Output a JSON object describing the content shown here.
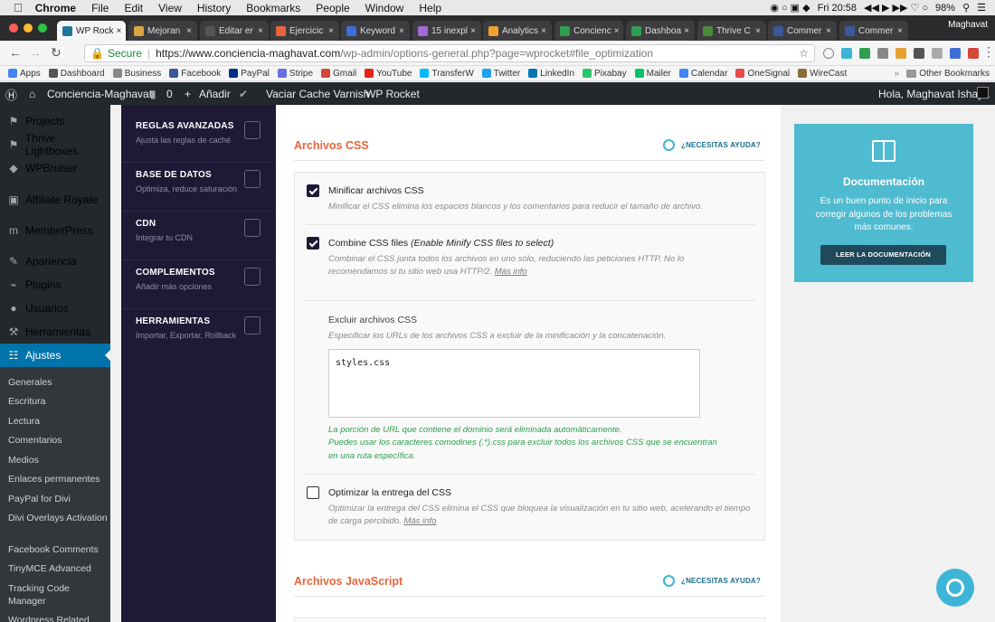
{
  "mac_menu": {
    "app": "Chrome",
    "items": [
      "File",
      "Edit",
      "View",
      "History",
      "Bookmarks",
      "People",
      "Window",
      "Help"
    ],
    "clock": "Fri 20:58",
    "battery": "98%"
  },
  "tabs": [
    {
      "label": "WP Rock",
      "color": "#21759b",
      "active": true
    },
    {
      "label": "Mejoran",
      "color": "#d9a441"
    },
    {
      "label": "Editar er",
      "color": "#555"
    },
    {
      "label": "Ejercicic",
      "color": "#e8653b"
    },
    {
      "label": "Keyword",
      "color": "#3b6fd6"
    },
    {
      "label": "15 inexpl",
      "color": "#a26ad6"
    },
    {
      "label": "Analytics",
      "color": "#f0a030"
    },
    {
      "label": "Concienc",
      "color": "#2e9e50"
    },
    {
      "label": "Dashboa",
      "color": "#2e9e50"
    },
    {
      "label": "Thrive C",
      "color": "#4a8a3a"
    },
    {
      "label": "Commer",
      "color": "#3b5998"
    },
    {
      "label": "Commer",
      "color": "#3b5998"
    }
  ],
  "profile": "Maghavat",
  "address": {
    "secure": "Secure",
    "host": "https://www.conciencia-maghavat.com",
    "path": "/wp-admin/options-general.php?page=wprocket#file_optimization"
  },
  "bookmarks": [
    {
      "label": "Apps",
      "color": "#4285f4"
    },
    {
      "label": "Dashboard",
      "color": "#555"
    },
    {
      "label": "Business",
      "color": "#888"
    },
    {
      "label": "Facebook",
      "color": "#3b5998"
    },
    {
      "label": "PayPal",
      "color": "#003087"
    },
    {
      "label": "Stripe",
      "color": "#6772e5"
    },
    {
      "label": "Gmail",
      "color": "#d44638"
    },
    {
      "label": "YouTube",
      "color": "#e62117"
    },
    {
      "label": "TransferW",
      "color": "#00b9ff"
    },
    {
      "label": "Twitter",
      "color": "#1da1f2"
    },
    {
      "label": "LinkedIn",
      "color": "#0077b5"
    },
    {
      "label": "Pixabay",
      "color": "#2ec66d"
    },
    {
      "label": "Mailer",
      "color": "#09c269"
    },
    {
      "label": "Calendar",
      "color": "#4285f4"
    },
    {
      "label": "OneSignal",
      "color": "#e54b4d"
    },
    {
      "label": "WireCast",
      "color": "#8a6d3b"
    }
  ],
  "other_bookmarks": "Other Bookmarks",
  "admin_bar": {
    "site": "Conciencia-Maghavat",
    "comments": "0",
    "add": "Añadir",
    "varnish": "Vaciar Cache Varnish",
    "rocket": "WP Rocket",
    "greeting": "Hola, Maghavat Ishaya"
  },
  "wp_menu": [
    {
      "label": "Projects",
      "icon": "pin-icon"
    },
    {
      "label": "Thrive Lightboxes",
      "icon": "pin-icon"
    },
    {
      "label": "WPBruiser",
      "icon": "shield-icon"
    },
    {
      "label": "Affiliate Royale",
      "icon": "wallet-icon"
    },
    {
      "label": "MemberPress",
      "icon": "mp-icon"
    },
    {
      "label": "Apariencia",
      "icon": "brush-icon"
    },
    {
      "label": "Plugins",
      "icon": "plug-icon"
    },
    {
      "label": "Usuarios",
      "icon": "user-icon"
    },
    {
      "label": "Herramientas",
      "icon": "wrench-icon"
    },
    {
      "label": "Ajustes",
      "icon": "settings-icon",
      "active": true
    }
  ],
  "wp_submenu": [
    "Generales",
    "Escritura",
    "Lectura",
    "Comentarios",
    "Medios",
    "Enlaces permanentes",
    "PayPal for Divi",
    "Divi Overlays Activation",
    "Facebook Comments",
    "TinyMCE Advanced",
    "Tracking Code Manager",
    "Wordpress Related"
  ],
  "rocket_nav": [
    {
      "title": "REGLAS AVANZADAS",
      "sub": "Ajusta las reglas de caché"
    },
    {
      "title": "BASE DE DATOS",
      "sub": "Optimiza, reduce saturación"
    },
    {
      "title": "CDN",
      "sub": "Integrar tu CDN"
    },
    {
      "title": "COMPLEMENTOS",
      "sub": "Añadir más opciones"
    },
    {
      "title": "HERRAMIENTAS",
      "sub": "Importar, Exportar, Rollback"
    }
  ],
  "css_section": {
    "title": "Archivos CSS",
    "help": "¿NECESITAS AYUDA?",
    "minify": {
      "label": "Minificar archivos CSS",
      "desc": "Minificar el CSS elimina los espacios blancos y los comentarios para reducir el tamaño de archivo.",
      "checked": true
    },
    "combine": {
      "label": "Combine CSS files",
      "label_note": "(Enable Minify CSS files to select)",
      "desc": "Combinar el CSS junta todos los archivos en uno sólo, reduciendo las peticiones HTTP. No lo recomendamos si tu sitio web usa HTTP/2.",
      "more": "Más info",
      "checked": true
    },
    "exclude": {
      "label": "Excluir archivos CSS",
      "desc": "Especificar los URLs de los archivos CSS a excluir de la minificación y la concatenación.",
      "value": "styles.css",
      "note1": "La porción de URL que contiene el dominio será eliminada automáticamente.",
      "note2": "Puedes usar los caracteres comodines (.*).css para excluir todos los archivos CSS que se encuentran en una ruta específica."
    },
    "optimize": {
      "label": "Optimizar la entrega del CSS",
      "desc": "Optimizar la entrega del CSS elimina el CSS que bloquea la visualización en tu sitio web, acelerando el tiempo de carga percibido.",
      "more": "Más info",
      "checked": false
    }
  },
  "js_section": {
    "title": "Archivos JavaScript",
    "help": "¿NECESITAS AYUDA?"
  },
  "doc_panel": {
    "title": "Documentación",
    "desc": "Es un buen punto de inicio para corregir algunos de los problemas más comunes.",
    "button": "LEER LA DOCUMENTACIÓN"
  }
}
